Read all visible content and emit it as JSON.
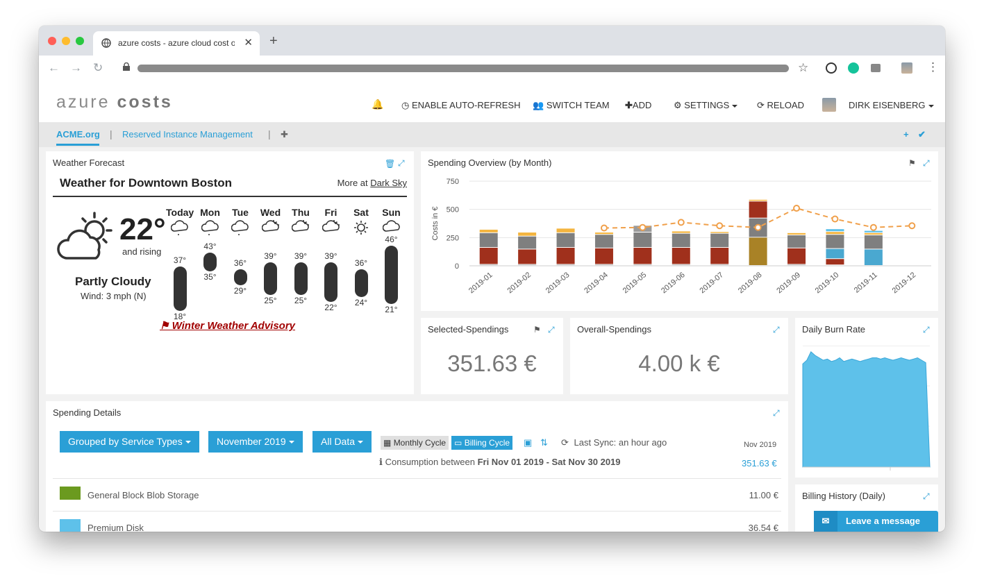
{
  "browser": {
    "tab_title": "azure costs - azure cloud cost o",
    "tab_close": "✕",
    "new_tab": "+"
  },
  "header": {
    "logo_light": "azure",
    "logo_bold": "costs",
    "bell": "🔔",
    "auto_refresh": "ENABLE AUTO-REFRESH",
    "switch_team": "SWITCH TEAM",
    "add": "ADD",
    "settings": "SETTINGS",
    "reload": "RELOAD",
    "user": "DIRK EISENBERG"
  },
  "subnav": {
    "tabs": [
      "ACME.org",
      "Reserved Instance Management"
    ],
    "sep": "|",
    "add": "✚"
  },
  "weather": {
    "panel_title": "Weather Forecast",
    "heading": "Weather for Downtown Boston",
    "more_prefix": "More at",
    "more_link": "Dark Sky",
    "current_temp": "22°",
    "trend": "and rising",
    "condition": "Partly Cloudy",
    "wind": "Wind: 3 mph (N)",
    "advisory": "⚑ Winter Weather Advisory",
    "days": [
      {
        "name": "Today",
        "icon": "cloud-drizzle-icon",
        "high": "37°",
        "low": "18°"
      },
      {
        "name": "Mon",
        "icon": "cloud-drizzle-icon",
        "high": "43°",
        "low": "35°"
      },
      {
        "name": "Tue",
        "icon": "cloud-drizzle-icon",
        "high": "36°",
        "low": "29°"
      },
      {
        "name": "Wed",
        "icon": "partly-cloudy-icon",
        "high": "39°",
        "low": "25°"
      },
      {
        "name": "Thu",
        "icon": "partly-cloudy-icon",
        "high": "39°",
        "low": "25°"
      },
      {
        "name": "Fri",
        "icon": "partly-cloudy-icon",
        "high": "39°",
        "low": "22°"
      },
      {
        "name": "Sat",
        "icon": "sun-icon",
        "high": "36°",
        "low": "24°"
      },
      {
        "name": "Sun",
        "icon": "cloud-icon",
        "high": "46°",
        "low": "21°"
      }
    ]
  },
  "overview": {
    "title": "Spending Overview (by Month)"
  },
  "chart_data": {
    "type": "bar",
    "title": "",
    "xlabel": "",
    "ylabel": "Costs in €",
    "ylim": [
      0,
      750
    ],
    "yticks": [
      "750",
      "500",
      "250",
      "0"
    ],
    "categories": [
      "2019-01",
      "2019-02",
      "2019-03",
      "2019-04",
      "2019-05",
      "2019-06",
      "2019-07",
      "2019-08",
      "2019-09",
      "2019-10",
      "2019-11",
      "2019-12"
    ],
    "series": [
      {
        "values": [
          10,
          10,
          10,
          10,
          10,
          10,
          10,
          0,
          10,
          5,
          0,
          0
        ],
        "color": "#9b9b9b"
      },
      {
        "values": [
          150,
          135,
          150,
          145,
          150,
          150,
          150,
          0,
          145,
          55,
          0,
          0
        ],
        "color": "#a0301c"
      },
      {
        "values": [
          0,
          0,
          0,
          0,
          0,
          0,
          0,
          250,
          0,
          0,
          0,
          0
        ],
        "color": "#a98226"
      },
      {
        "values": [
          0,
          0,
          0,
          0,
          0,
          0,
          0,
          0,
          0,
          90,
          145,
          0
        ],
        "color": "#4aa8d0"
      },
      {
        "values": [
          130,
          115,
          130,
          120,
          135,
          125,
          125,
          170,
          115,
          125,
          125,
          0
        ],
        "color": "#7f7f7f"
      },
      {
        "values": [
          0,
          0,
          0,
          0,
          0,
          0,
          0,
          150,
          0,
          0,
          0,
          0
        ],
        "color": "#a0301c"
      },
      {
        "values": [
          0,
          0,
          0,
          0,
          60,
          0,
          0,
          0,
          0,
          0,
          0,
          0
        ],
        "color": "#9b9b9b"
      },
      {
        "values": [
          30,
          35,
          40,
          20,
          0,
          20,
          15,
          15,
          20,
          25,
          20,
          0
        ],
        "color": "#f4b53f"
      },
      {
        "values": [
          0,
          0,
          0,
          0,
          0,
          0,
          0,
          0,
          0,
          25,
          20,
          0
        ],
        "color": "#5ec1ea"
      }
    ],
    "line": {
      "values": [
        null,
        null,
        null,
        335,
        340,
        385,
        355,
        340,
        510,
        415,
        340,
        355
      ],
      "color": "#f0a04b"
    },
    "grid": true
  },
  "selected": {
    "title": "Selected-Spendings",
    "value": "351.63  €"
  },
  "overall": {
    "title": "Overall-Spendings",
    "value": "4.00 k €"
  },
  "burn": {
    "title": "Daily Burn Rate",
    "values": [
      85,
      88,
      95,
      92,
      90,
      88,
      89,
      87,
      88,
      90,
      87,
      88,
      89,
      88,
      87,
      88,
      89,
      90,
      90,
      89,
      90,
      89,
      88,
      89,
      90,
      89,
      88,
      89,
      90,
      88,
      86,
      0
    ],
    "color": "#5ec1ea"
  },
  "billing_history": {
    "title": "Billing History (Daily)"
  },
  "details": {
    "title": "Spending Details",
    "group_btn": "Grouped by Service Types",
    "month_btn": "November 2019",
    "data_btn": "All Data",
    "monthly_cycle": "Monthly Cycle",
    "billing_cycle": "Billing Cycle",
    "last_sync": "Last Sync: an hour ago",
    "period_label": "Nov 2019",
    "period_value": "351.63 €",
    "consumption_prefix": "Consumption between",
    "consumption_from": "Fri Nov 01 2019",
    "consumption_dash": " - ",
    "consumption_to": "Sat Nov 30 2019",
    "rows": [
      {
        "label": "General Block Blob Storage",
        "value": "11.00 €",
        "color": "#6b9a1f"
      },
      {
        "label": "Premium Disk",
        "value": "36.54 €",
        "color": "#5ec1ea"
      }
    ]
  },
  "chat": {
    "label": "Leave a message"
  }
}
